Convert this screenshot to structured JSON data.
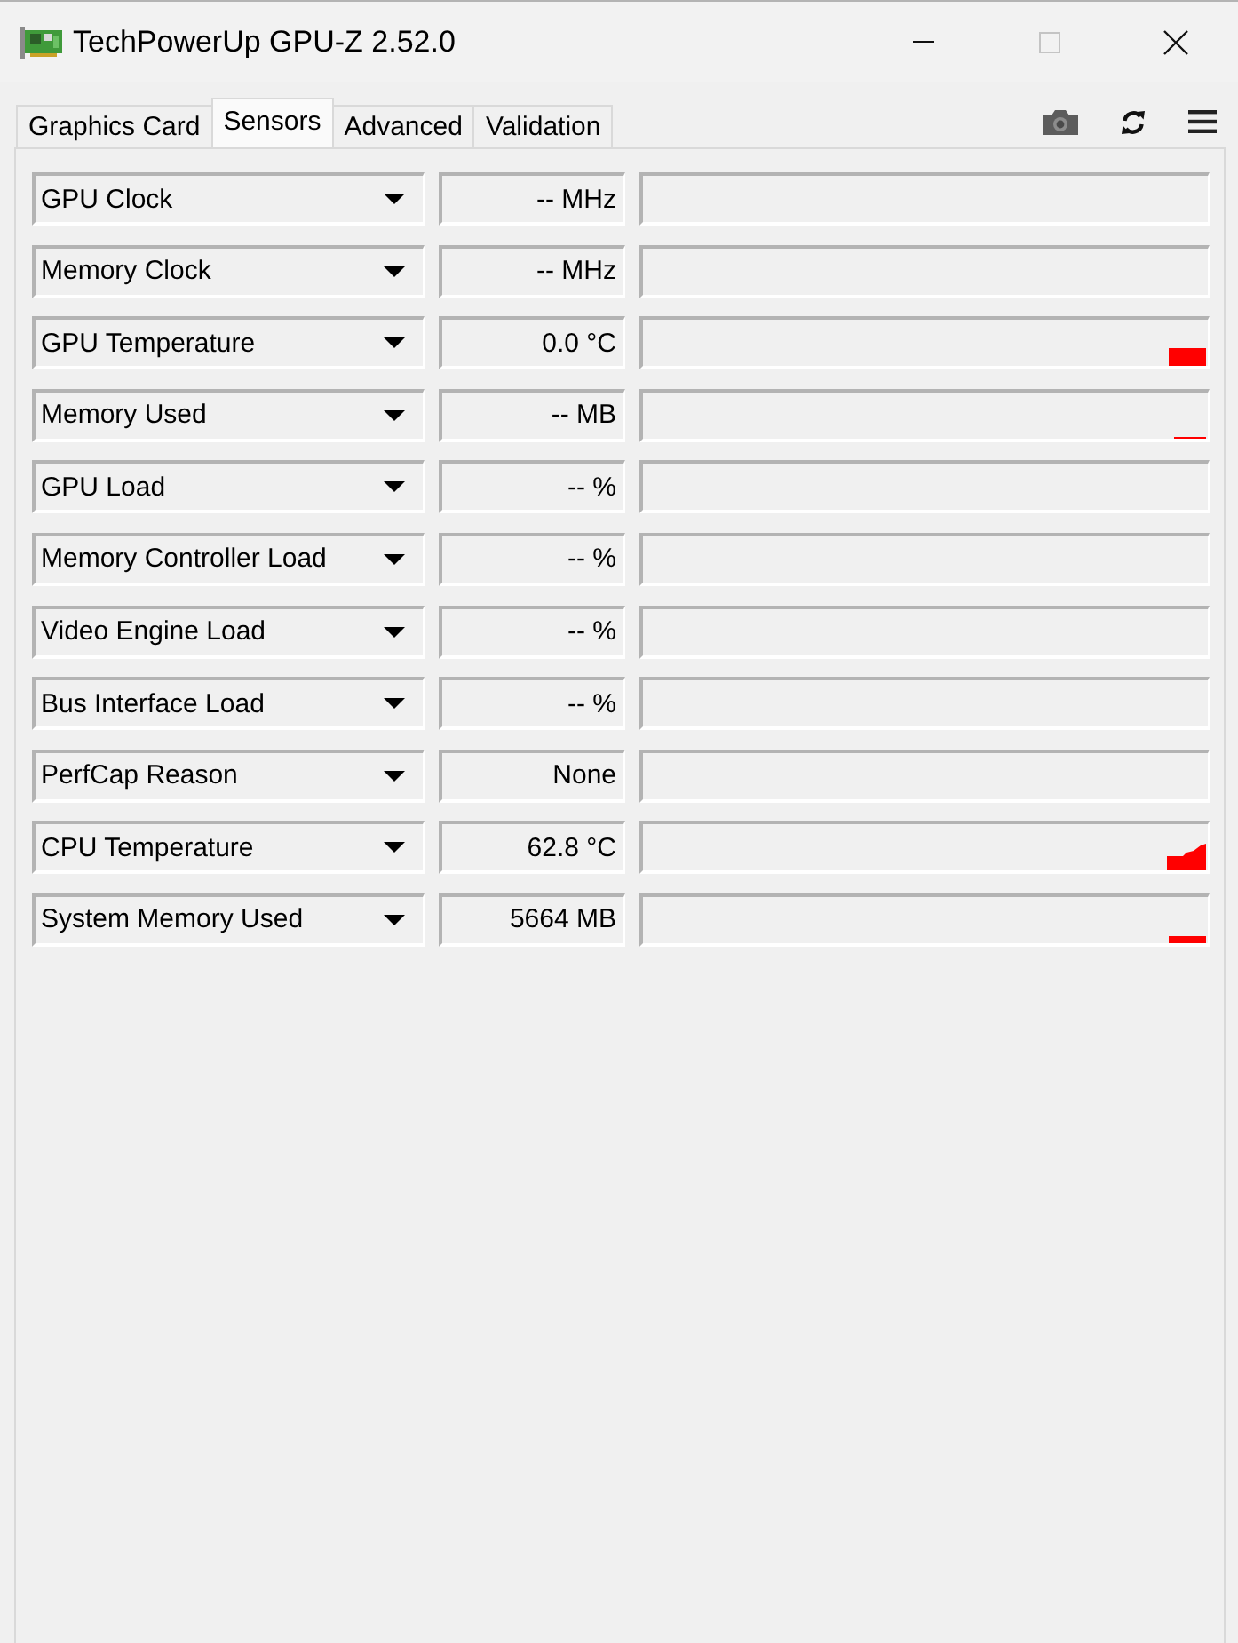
{
  "window": {
    "title": "TechPowerUp GPU-Z 2.52.0",
    "maximize_disabled": true
  },
  "tabs": [
    {
      "label": "Graphics Card",
      "selected": false
    },
    {
      "label": "Sensors",
      "selected": true
    },
    {
      "label": "Advanced",
      "selected": false
    },
    {
      "label": "Validation",
      "selected": false
    }
  ],
  "sensors": [
    {
      "kind": "empty",
      "name": "GPU Clock",
      "reading": "-- MHz"
    },
    {
      "kind": "empty",
      "name": "Memory Clock",
      "reading": "-- MHz"
    },
    {
      "kind": "block",
      "name": "GPU Temperature",
      "reading": "0.0 °C"
    },
    {
      "kind": "line",
      "name": "Memory Used",
      "reading": "-- MB"
    },
    {
      "kind": "empty",
      "name": "GPU Load",
      "reading": "-- %"
    },
    {
      "kind": "empty",
      "name": "Memory Controller Load",
      "reading": "-- %"
    },
    {
      "kind": "empty",
      "name": "Video Engine Load",
      "reading": "-- %"
    },
    {
      "kind": "empty",
      "name": "Bus Interface Load",
      "reading": "-- %"
    },
    {
      "kind": "empty",
      "name": "PerfCap Reason",
      "reading": "None"
    },
    {
      "kind": "steps",
      "name": "CPU Temperature",
      "reading": "62.8 °C"
    },
    {
      "kind": "bar",
      "name": "System Memory Used",
      "reading": "5664 MB"
    }
  ]
}
